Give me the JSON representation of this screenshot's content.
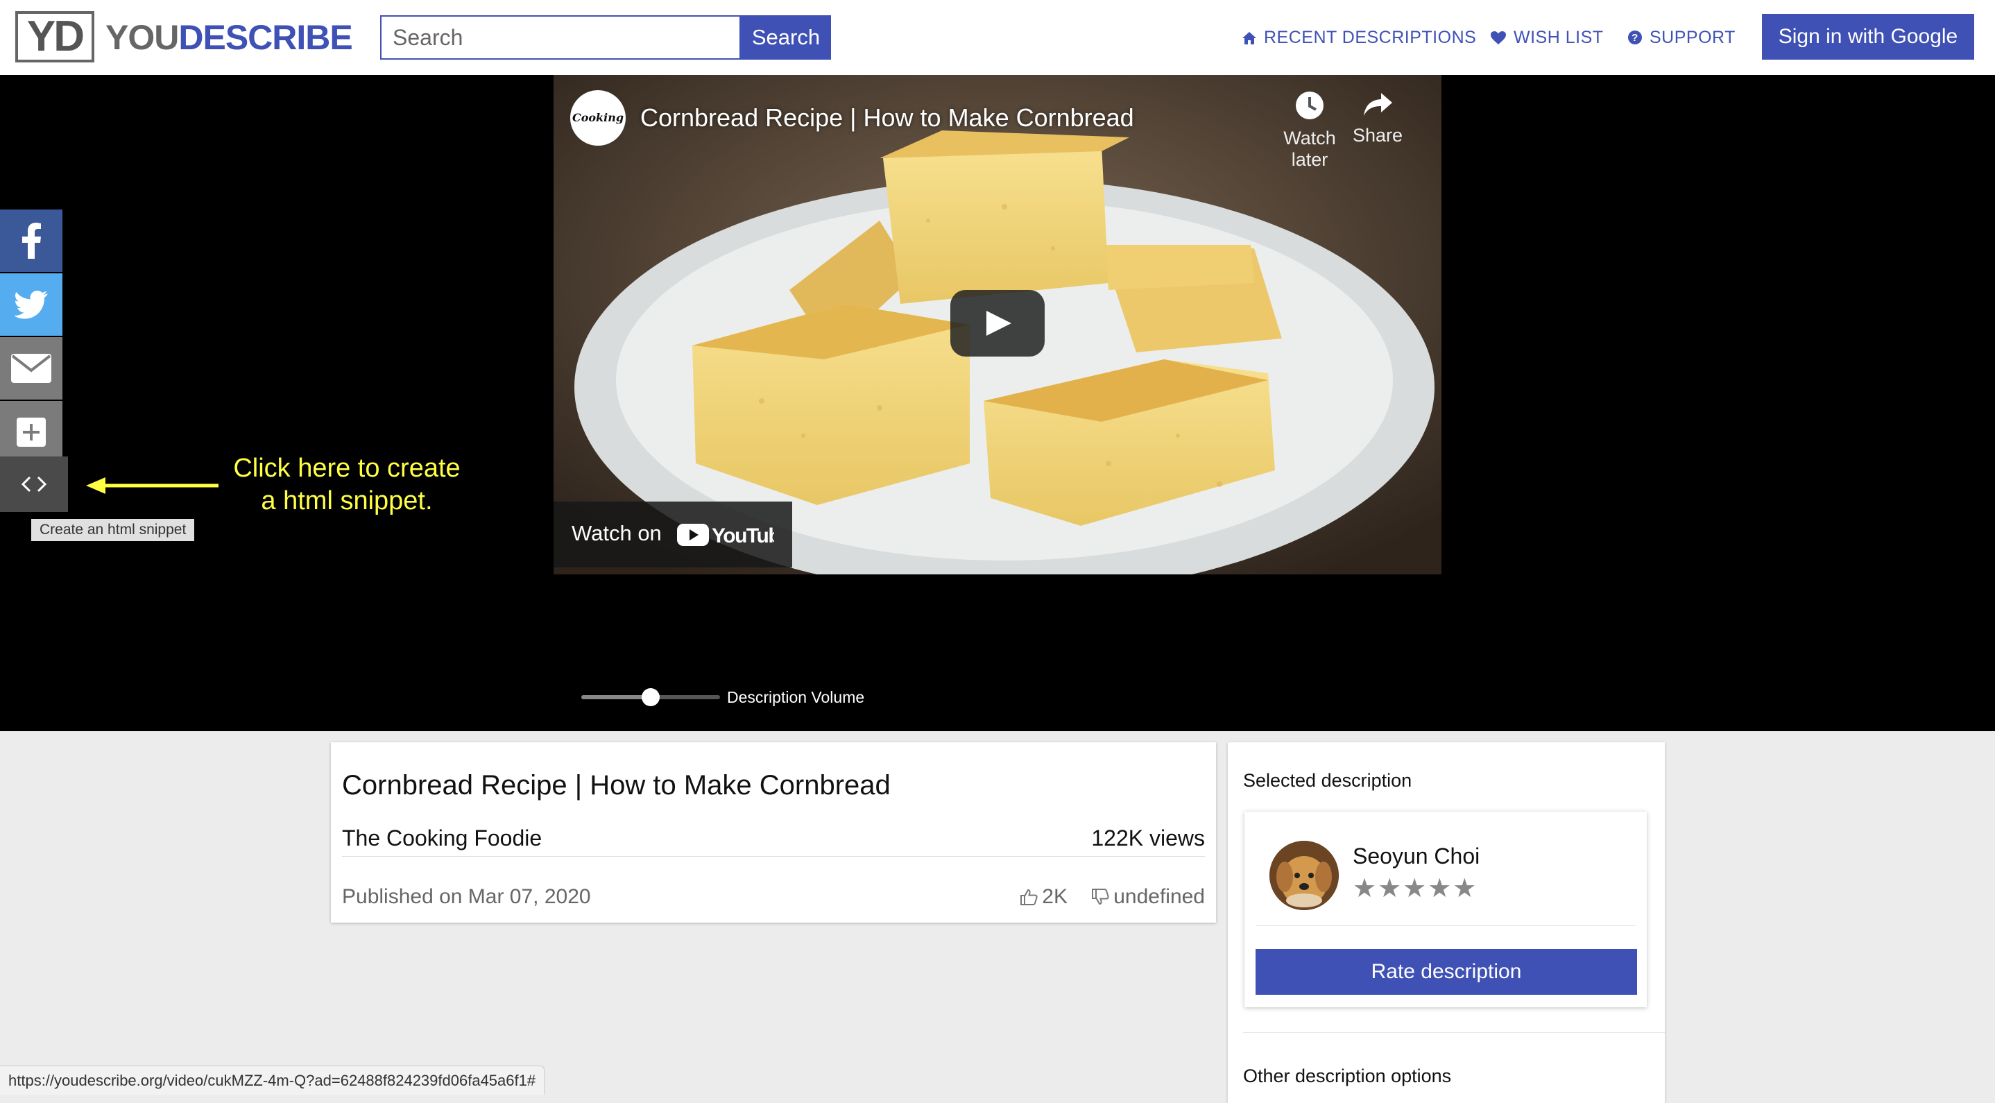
{
  "header": {
    "logo_mark": "YD",
    "logo_you": "YOU",
    "logo_describe": "DESCRIBE",
    "search_placeholder": "Search",
    "search_button": "Search",
    "nav": [
      {
        "label": "RECENT DESCRIPTIONS",
        "icon": "home-icon"
      },
      {
        "label": "WISH LIST",
        "icon": "heart-icon"
      },
      {
        "label": "SUPPORT",
        "icon": "question-circle-icon"
      }
    ],
    "signin_button": "Sign in with Google"
  },
  "video": {
    "title": "Cornbread Recipe | How to Make Cornbread",
    "channel_logo_text": "Cooking",
    "watch_later": "Watch later",
    "share": "Share",
    "watch_on": "Watch on",
    "youtube": "YouTube"
  },
  "share_bar": {
    "items": [
      "facebook-icon",
      "twitter-icon",
      "email-icon",
      "plus-icon",
      "code-icon"
    ],
    "tooltip": "Create an html snippet"
  },
  "annotation": {
    "line1": "Click here to create",
    "line2": "a html snippet."
  },
  "volume": {
    "label": "Description Volume",
    "level": 0.5
  },
  "info": {
    "title": "Cornbread Recipe | How to Make Cornbread",
    "channel": "The Cooking Foodie",
    "views": "122K views",
    "published": "Published on Mar 07, 2020",
    "likes": "2K",
    "dislikes": "undefined"
  },
  "description_panel": {
    "heading": "Selected description",
    "author": "Seoyun Choi",
    "rating_max": 5,
    "stars": "★★★★★",
    "rate_button": "Rate description",
    "other_heading": "Other description options"
  },
  "status_bar": {
    "url": "https://youdescribe.org/video/cukMZZ-4m-Q?ad=62488f824239fd06fa45a6f1#"
  },
  "colors": {
    "brand": "#3f51b5",
    "facebook": "#3b5998",
    "twitter": "#55acee",
    "annotation": "#ffff44"
  }
}
